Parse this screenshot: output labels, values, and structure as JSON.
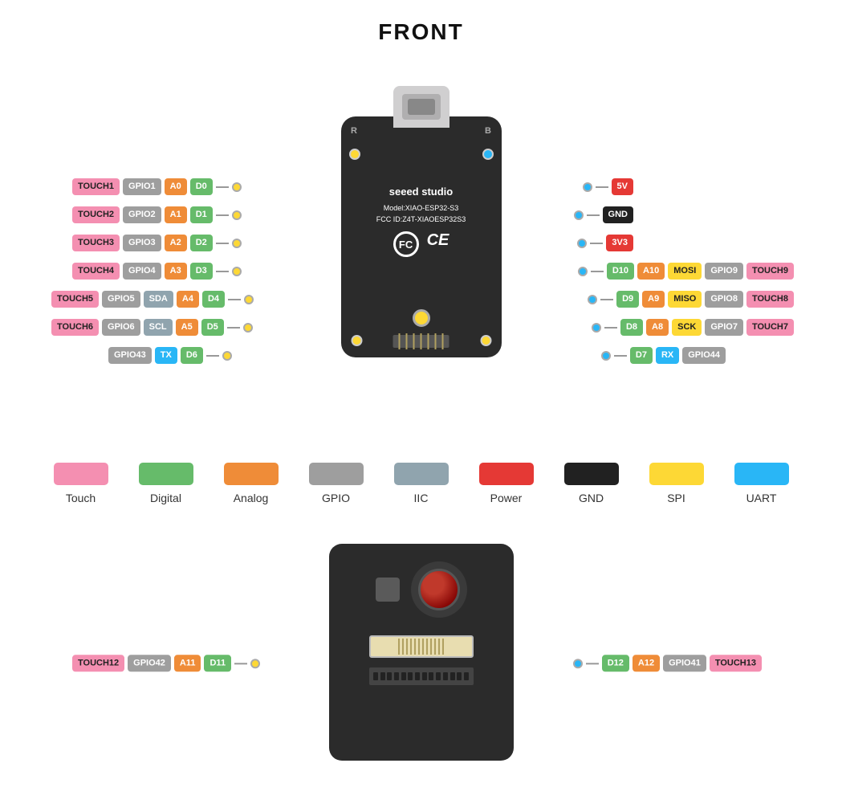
{
  "title": "FRONT",
  "legend": [
    {
      "label": "Touch",
      "color": "#f48fb1",
      "class": "touch"
    },
    {
      "label": "Digital",
      "color": "#66bb6a",
      "class": "digital"
    },
    {
      "label": "Analog",
      "color": "#ef8c38",
      "class": "analog"
    },
    {
      "label": "GPIO",
      "color": "#9e9e9e",
      "class": "gpio"
    },
    {
      "label": "IIC",
      "color": "#90a4ae",
      "class": "iic"
    },
    {
      "label": "Power",
      "color": "#e53935",
      "class": "power"
    },
    {
      "label": "GND",
      "color": "#212121",
      "class": "gnd"
    },
    {
      "label": "SPI",
      "color": "#fdd835",
      "class": "spi"
    },
    {
      "label": "UART",
      "color": "#29b6f6",
      "class": "uart"
    }
  ],
  "board": {
    "brand": "seeed studio",
    "model": "Model:XIAO-ESP32-S3",
    "fcc": "FCC ID:Z4T-XIAOESP32S3"
  },
  "left_pins": [
    [
      {
        "text": "TOUCH1",
        "class": "touch"
      },
      {
        "text": "GPIO1",
        "class": "gpio"
      },
      {
        "text": "A0",
        "class": "analog"
      },
      {
        "text": "D0",
        "class": "digital"
      }
    ],
    [
      {
        "text": "TOUCH2",
        "class": "touch"
      },
      {
        "text": "GPIO2",
        "class": "gpio"
      },
      {
        "text": "A1",
        "class": "analog"
      },
      {
        "text": "D1",
        "class": "digital"
      }
    ],
    [
      {
        "text": "TOUCH3",
        "class": "touch"
      },
      {
        "text": "GPIO3",
        "class": "gpio"
      },
      {
        "text": "A2",
        "class": "analog"
      },
      {
        "text": "D2",
        "class": "digital"
      }
    ],
    [
      {
        "text": "TOUCH4",
        "class": "touch"
      },
      {
        "text": "GPIO4",
        "class": "gpio"
      },
      {
        "text": "A3",
        "class": "analog"
      },
      {
        "text": "D3",
        "class": "digital"
      }
    ],
    [
      {
        "text": "TOUCH5",
        "class": "touch"
      },
      {
        "text": "GPIO5",
        "class": "gpio"
      },
      {
        "text": "SDA",
        "class": "iic"
      },
      {
        "text": "A4",
        "class": "analog"
      },
      {
        "text": "D4",
        "class": "digital"
      }
    ],
    [
      {
        "text": "TOUCH6",
        "class": "touch"
      },
      {
        "text": "GPIO6",
        "class": "gpio"
      },
      {
        "text": "SCL",
        "class": "iic"
      },
      {
        "text": "A5",
        "class": "analog"
      },
      {
        "text": "D5",
        "class": "digital"
      }
    ],
    [
      {
        "text": "GPIO43",
        "class": "gpio"
      },
      {
        "text": "TX",
        "class": "uart"
      },
      {
        "text": "D6",
        "class": "digital"
      }
    ]
  ],
  "right_pins": [
    [
      {
        "text": "5V",
        "class": "power"
      }
    ],
    [
      {
        "text": "GND",
        "class": "gnd"
      }
    ],
    [
      {
        "text": "3V3",
        "class": "v3"
      }
    ],
    [
      {
        "text": "D10",
        "class": "digital"
      },
      {
        "text": "A10",
        "class": "analog"
      },
      {
        "text": "MOSI",
        "class": "spi"
      },
      {
        "text": "GPIO9",
        "class": "gpio"
      },
      {
        "text": "TOUCH9",
        "class": "touch"
      }
    ],
    [
      {
        "text": "D9",
        "class": "digital"
      },
      {
        "text": "A9",
        "class": "analog"
      },
      {
        "text": "MISO",
        "class": "spi"
      },
      {
        "text": "GPIO8",
        "class": "gpio"
      },
      {
        "text": "TOUCH8",
        "class": "touch"
      }
    ],
    [
      {
        "text": "D8",
        "class": "digital"
      },
      {
        "text": "A8",
        "class": "analog"
      },
      {
        "text": "SCK",
        "class": "spi"
      },
      {
        "text": "GPIO7",
        "class": "gpio"
      },
      {
        "text": "TOUCH7",
        "class": "touch"
      }
    ],
    [
      {
        "text": "D7",
        "class": "digital"
      },
      {
        "text": "RX",
        "class": "uart"
      },
      {
        "text": "GPIO44",
        "class": "gpio"
      }
    ]
  ],
  "bottom_left_pins": [
    {
      "text": "TOUCH12",
      "class": "touch"
    },
    {
      "text": "GPIO42",
      "class": "gpio"
    },
    {
      "text": "A11",
      "class": "analog"
    },
    {
      "text": "D11",
      "class": "digital"
    }
  ],
  "bottom_right_pins": [
    {
      "text": "D12",
      "class": "digital"
    },
    {
      "text": "A12",
      "class": "analog"
    },
    {
      "text": "GPIO41",
      "class": "gpio"
    },
    {
      "text": "TOUCH13",
      "class": "touch"
    }
  ]
}
